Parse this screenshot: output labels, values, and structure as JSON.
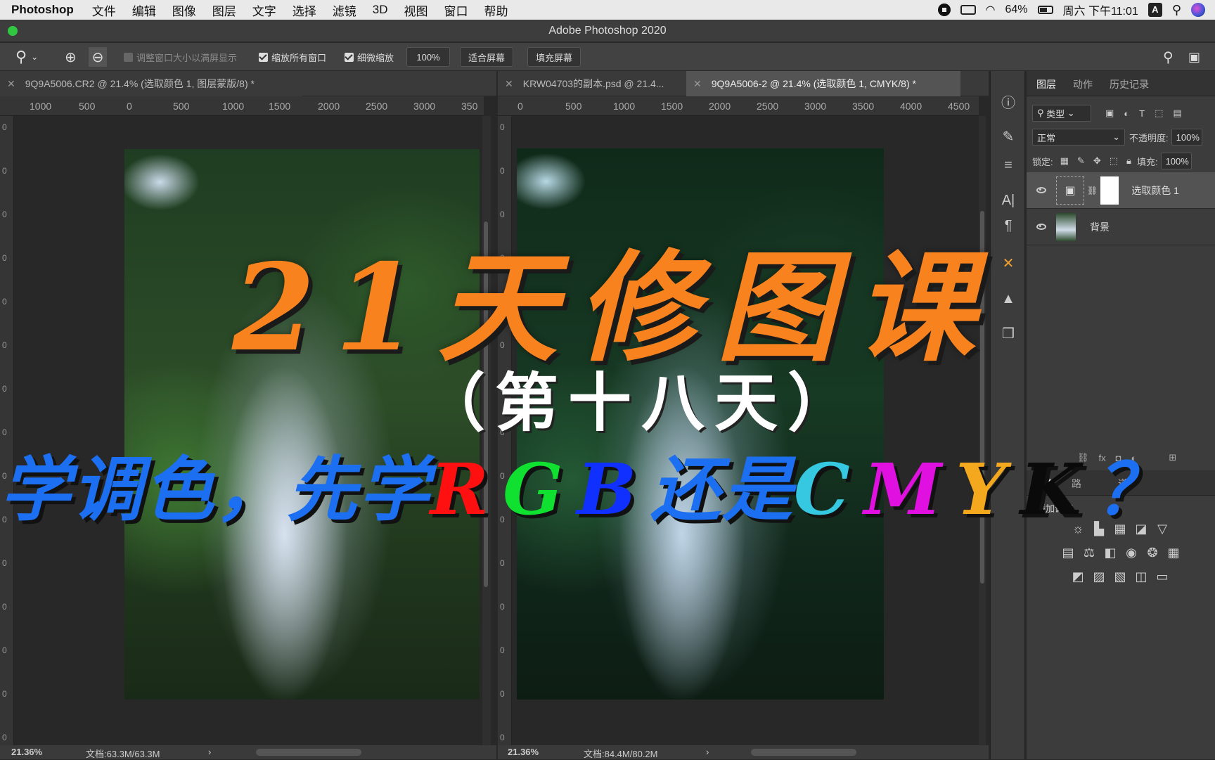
{
  "menubar": {
    "app": "Photoshop",
    "items": [
      "文件",
      "编辑",
      "图像",
      "图层",
      "文字",
      "选择",
      "滤镜",
      "3D",
      "视图",
      "窗口",
      "帮助"
    ],
    "battery": "64%",
    "clock": "周六 下午11:01",
    "input_method": "A"
  },
  "window": {
    "title": "Adobe Photoshop 2020"
  },
  "options": {
    "resize_window": "调整窗口大小以满屏显示",
    "zoom_all": "缩放所有窗口",
    "scrubby_zoom": "细微缩放",
    "zoom_value": "100%",
    "fit_screen": "适合屏幕",
    "fill_screen": "填充屏幕"
  },
  "docs": {
    "left_tab": "9Q9A5006.CR2 @ 21.4% (选取颜色 1, 图层蒙版/8) *",
    "right_tab_1": "KRW04703的副本.psd @ 21.4...",
    "right_tab_2": "9Q9A5006-2 @ 21.4% (选取颜色 1, CMYK/8) *",
    "left_ruler": [
      "1000",
      "500",
      "0",
      "500",
      "1000",
      "1500",
      "2000",
      "2500",
      "3000",
      "350"
    ],
    "right_ruler": [
      "0",
      "500",
      "1000",
      "1500",
      "2000",
      "2500",
      "3000",
      "3500",
      "4000",
      "4500"
    ],
    "left_status_zoom": "21.36%",
    "left_status_doc": "文档:63.3M/63.3M",
    "right_status_zoom": "21.36%",
    "right_status_doc": "文档:84.4M/80.2M"
  },
  "layers_panel": {
    "tabs": [
      "图层",
      "动作",
      "历史记录"
    ],
    "filter_kind": "类型",
    "blend_mode": "正常",
    "opacity_label": "不透明度:",
    "opacity_value": "100%",
    "lock_label": "锁定:",
    "fill_label": "填充:",
    "fill_value": "100%",
    "layers": [
      "选取颜色 1",
      "背景"
    ]
  },
  "adjustments_panel": {
    "tabs": [
      "整",
      "路",
      "道"
    ],
    "title": "添加调整"
  },
  "overlay": {
    "headline": "21天修图课",
    "subtitle": "（第十八天）",
    "question_parts": [
      {
        "text": "学调色，先学",
        "color": "#1b6ff0"
      },
      {
        "text": "R",
        "color": "#ff1010"
      },
      {
        "text": "G",
        "color": "#10e030"
      },
      {
        "text": "B",
        "color": "#1030ff"
      },
      {
        "text": "还是",
        "color": "#1b6ff0"
      },
      {
        "text": "C",
        "color": "#35c8e0"
      },
      {
        "text": "M",
        "color": "#e010e0"
      },
      {
        "text": "Y",
        "color": "#f4a81e"
      },
      {
        "text": "K",
        "color": "#0a0a0a"
      },
      {
        "text": "？",
        "color": "#1b6ff0"
      }
    ]
  },
  "colors": {
    "headline": "#f7821e",
    "accent_blue": "#1b6ff0"
  }
}
